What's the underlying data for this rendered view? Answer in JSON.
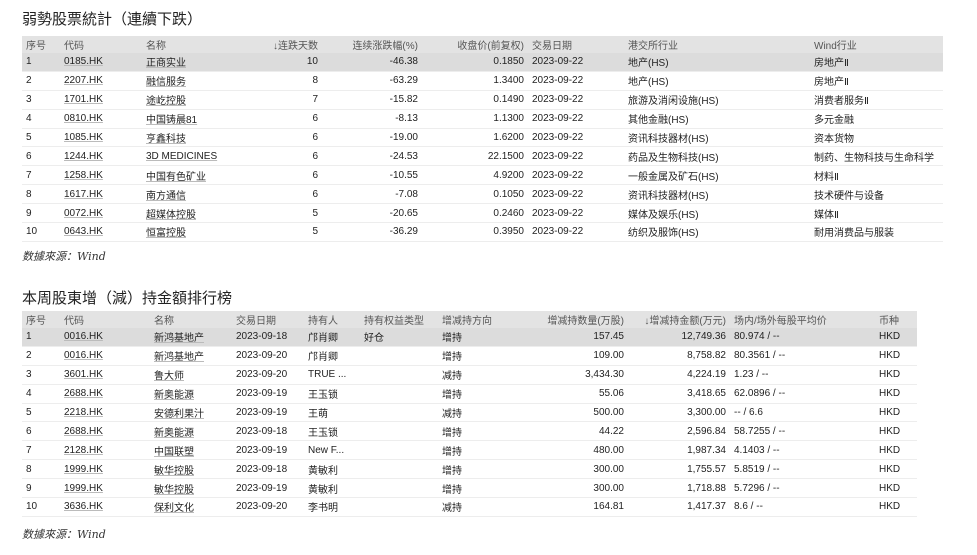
{
  "section1": {
    "title": "弱勢股票統計（連續下跌）",
    "columns": [
      "序号",
      "代码",
      "名称",
      "↓连跌天数",
      "连续涨跌幅(%)",
      "收盘价(前复权)",
      "交易日期",
      "港交所行业",
      "Wind行业"
    ],
    "rows": [
      {
        "idx": "1",
        "code": "0185.HK",
        "name": "正商实业",
        "days": "10",
        "chg": "-46.38",
        "close": "0.1850",
        "date": "2023-09-22",
        "hkex": "地产(HS)",
        "wind": "房地产Ⅱ"
      },
      {
        "idx": "2",
        "code": "2207.HK",
        "name": "融信服务",
        "days": "8",
        "chg": "-63.29",
        "close": "1.3400",
        "date": "2023-09-22",
        "hkex": "地产(HS)",
        "wind": "房地产Ⅱ"
      },
      {
        "idx": "3",
        "code": "1701.HK",
        "name": "途屹控股",
        "days": "7",
        "chg": "-15.82",
        "close": "0.1490",
        "date": "2023-09-22",
        "hkex": "旅游及消闲设施(HS)",
        "wind": "消费者服务Ⅱ"
      },
      {
        "idx": "4",
        "code": "0810.HK",
        "name": "中国铸晨81",
        "days": "6",
        "chg": "-8.13",
        "close": "1.1300",
        "date": "2023-09-22",
        "hkex": "其他金融(HS)",
        "wind": "多元金融"
      },
      {
        "idx": "5",
        "code": "1085.HK",
        "name": "亨鑫科技",
        "days": "6",
        "chg": "-19.00",
        "close": "1.6200",
        "date": "2023-09-22",
        "hkex": "资讯科技器材(HS)",
        "wind": "资本货物"
      },
      {
        "idx": "6",
        "code": "1244.HK",
        "name": "3D MEDICINES",
        "days": "6",
        "chg": "-24.53",
        "close": "22.1500",
        "date": "2023-09-22",
        "hkex": "药品及生物科技(HS)",
        "wind": "制药、生物科技与生命科学"
      },
      {
        "idx": "7",
        "code": "1258.HK",
        "name": "中国有色矿业",
        "days": "6",
        "chg": "-10.55",
        "close": "4.9200",
        "date": "2023-09-22",
        "hkex": "一般金属及矿石(HS)",
        "wind": "材料Ⅱ"
      },
      {
        "idx": "8",
        "code": "1617.HK",
        "name": "南方通信",
        "days": "6",
        "chg": "-7.08",
        "close": "0.1050",
        "date": "2023-09-22",
        "hkex": "资讯科技器材(HS)",
        "wind": "技术硬件与设备"
      },
      {
        "idx": "9",
        "code": "0072.HK",
        "name": "超媒体控股",
        "days": "5",
        "chg": "-20.65",
        "close": "0.2460",
        "date": "2023-09-22",
        "hkex": "媒体及娱乐(HS)",
        "wind": "媒体Ⅱ"
      },
      {
        "idx": "10",
        "code": "0643.HK",
        "name": "恒富控股",
        "days": "5",
        "chg": "-36.29",
        "close": "0.3950",
        "date": "2023-09-22",
        "hkex": "纺织及服饰(HS)",
        "wind": "耐用消费品与服装"
      }
    ],
    "source": "数據來源：Wind"
  },
  "section2": {
    "title": "本周股東增（減）持金額排行榜",
    "columns": [
      "序号",
      "代码",
      "名称",
      "交易日期",
      "持有人",
      "持有权益类型",
      "增减持方向",
      "增减持数量(万股)",
      "↓增减持金额(万元)",
      "场内/场外每股平均价",
      "币种"
    ],
    "rows": [
      {
        "idx": "1",
        "code": "0016.HK",
        "name": "新鸿基地产",
        "date": "2023-09-18",
        "holder": "邝肖卿",
        "type": "好仓",
        "dir": "增持",
        "qty": "157.45",
        "amt": "12,749.36",
        "avg": "80.974 / --",
        "ccy": "HKD"
      },
      {
        "idx": "2",
        "code": "0016.HK",
        "name": "新鸿基地产",
        "date": "2023-09-20",
        "holder": "邝肖卿",
        "type": "",
        "dir": "增持",
        "qty": "109.00",
        "amt": "8,758.82",
        "avg": "80.3561 / --",
        "ccy": "HKD"
      },
      {
        "idx": "3",
        "code": "3601.HK",
        "name": "鲁大师",
        "date": "2023-09-20",
        "holder": "TRUE ...",
        "type": "",
        "dir": "减持",
        "qty": "3,434.30",
        "amt": "4,224.19",
        "avg": "1.23 / --",
        "ccy": "HKD"
      },
      {
        "idx": "4",
        "code": "2688.HK",
        "name": "新奥能源",
        "date": "2023-09-19",
        "holder": "王玉锁",
        "type": "",
        "dir": "增持",
        "qty": "55.06",
        "amt": "3,418.65",
        "avg": "62.0896 / --",
        "ccy": "HKD"
      },
      {
        "idx": "5",
        "code": "2218.HK",
        "name": "安德利果汁",
        "date": "2023-09-19",
        "holder": "王萌",
        "type": "",
        "dir": "减持",
        "qty": "500.00",
        "amt": "3,300.00",
        "avg": "-- / 6.6",
        "ccy": "HKD"
      },
      {
        "idx": "6",
        "code": "2688.HK",
        "name": "新奥能源",
        "date": "2023-09-18",
        "holder": "王玉锁",
        "type": "",
        "dir": "增持",
        "qty": "44.22",
        "amt": "2,596.84",
        "avg": "58.7255 / --",
        "ccy": "HKD"
      },
      {
        "idx": "7",
        "code": "2128.HK",
        "name": "中国联塑",
        "date": "2023-09-19",
        "holder": "New F...",
        "type": "",
        "dir": "增持",
        "qty": "480.00",
        "amt": "1,987.34",
        "avg": "4.1403 / --",
        "ccy": "HKD"
      },
      {
        "idx": "8",
        "code": "1999.HK",
        "name": "敏华控股",
        "date": "2023-09-18",
        "holder": "黄敏利",
        "type": "",
        "dir": "增持",
        "qty": "300.00",
        "amt": "1,755.57",
        "avg": "5.8519 / --",
        "ccy": "HKD"
      },
      {
        "idx": "9",
        "code": "1999.HK",
        "name": "敏华控股",
        "date": "2023-09-19",
        "holder": "黄敏利",
        "type": "",
        "dir": "增持",
        "qty": "300.00",
        "amt": "1,718.88",
        "avg": "5.7296 / --",
        "ccy": "HKD"
      },
      {
        "idx": "10",
        "code": "3636.HK",
        "name": "保利文化",
        "date": "2023-09-20",
        "holder": "李书明",
        "type": "",
        "dir": "减持",
        "qty": "164.81",
        "amt": "1,417.37",
        "avg": "8.6 / --",
        "ccy": "HKD"
      }
    ],
    "source": "数據來源：Wind"
  }
}
